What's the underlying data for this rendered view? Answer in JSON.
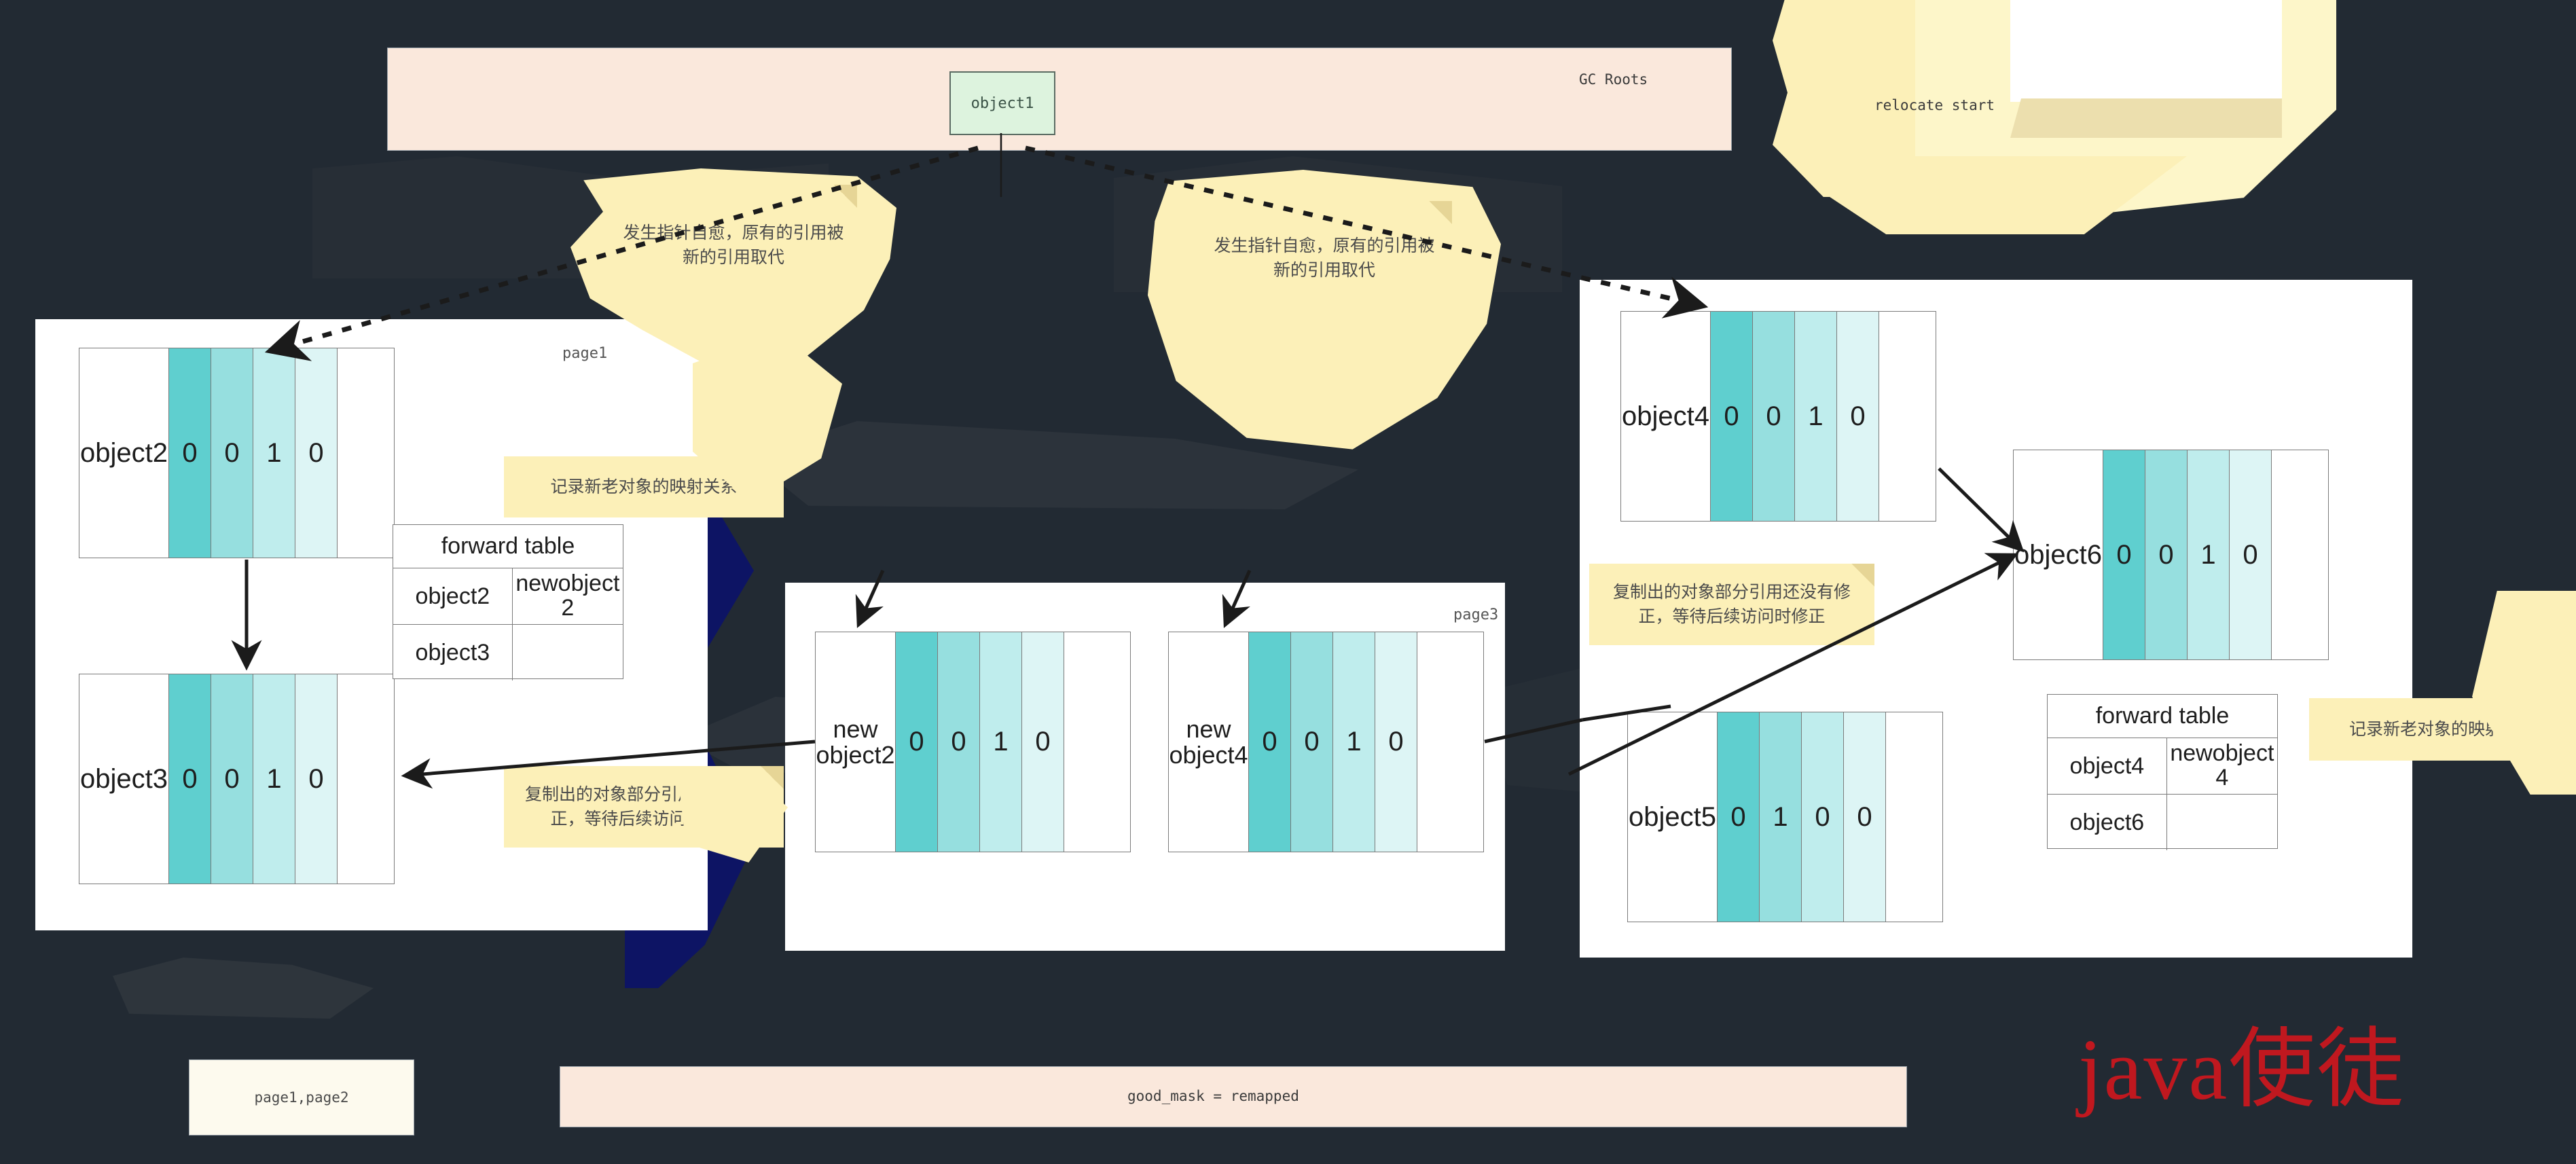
{
  "background_color": "#222a33",
  "accent_colors": {
    "peach_bar": "#fae8dc",
    "callout_yellow": "#fcf0b8",
    "navy_band": "#0d1464",
    "cell_1": "#5fcfcf",
    "cell_2": "#96dfdf",
    "cell_3": "#bfeded",
    "cell_4": "#ddf5f5",
    "watermark_red": "#c0181f",
    "object1_green": "#ddf3de"
  },
  "gc_roots_bar": {
    "label": "GC Roots",
    "object_box": "object1"
  },
  "relocate_note": "relocate start",
  "left_panel": {
    "page_tag": "page1",
    "objects": [
      {
        "name": "object2",
        "values": [
          "0",
          "0",
          "1",
          "0"
        ]
      },
      {
        "name": "object3",
        "values": [
          "0",
          "0",
          "1",
          "0"
        ]
      }
    ],
    "forward_table": {
      "header": "forward table",
      "rows": [
        {
          "key": "object2",
          "value": "newobject 2"
        },
        {
          "key": "object3",
          "value": ""
        }
      ]
    }
  },
  "middle_panel": {
    "page_tag": "page3",
    "objects": [
      {
        "name": "new object2",
        "values": [
          "0",
          "0",
          "1",
          "0"
        ]
      },
      {
        "name": "new object4",
        "values": [
          "0",
          "0",
          "1",
          "0"
        ]
      }
    ]
  },
  "right_panel": {
    "objects": [
      {
        "name": "object4",
        "values": [
          "0",
          "0",
          "1",
          "0"
        ]
      },
      {
        "name": "object6",
        "values": [
          "0",
          "0",
          "1",
          "0"
        ]
      },
      {
        "name": "object5",
        "values": [
          "0",
          "1",
          "0",
          "0"
        ]
      }
    ],
    "forward_table": {
      "header": "forward table",
      "rows": [
        {
          "key": "object4",
          "value": "newobject 4"
        },
        {
          "key": "object6",
          "value": ""
        }
      ]
    }
  },
  "callouts": {
    "self_heal_left": "发生指针自愈，原有的引用被新的引用取代",
    "self_heal_right": "发生指针自愈，原有的引用被新的引用取代",
    "mapping_left": "记录新老对象的映射关系",
    "mapping_right": "记录新老对象的映射关系",
    "partial_fix_left": "复制出的对象部分引用还没有修正，等待后续访问时修正",
    "partial_fix_right": "复制出的对象部分引用还没有修正，等待后续访问时修正"
  },
  "footer": {
    "pages_box": "page1,page2",
    "good_mask": "good_mask = remapped"
  },
  "watermark": "java使徒"
}
